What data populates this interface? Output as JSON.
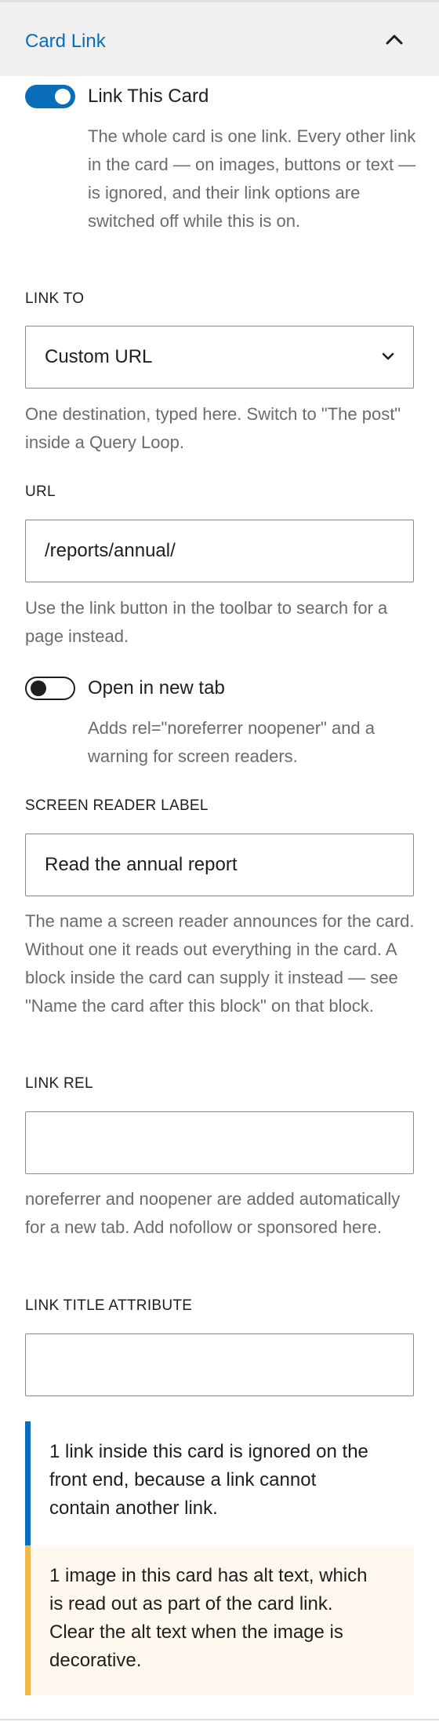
{
  "colors": {
    "accent": "#0a6dbb",
    "info_bar": "#0a6dbb",
    "warning_bar": "#f0b849",
    "warning_bg": "#fef8ee"
  },
  "panel": {
    "title": "Card Link",
    "collapse_icon": "chevron-up-icon"
  },
  "link_card": {
    "toggle_label": "Link This Card",
    "enabled": true,
    "help": "The whole card is one link. Every other link in the card — on images, buttons or text — is ignored, and their link options are switched off while this is on."
  },
  "link_to": {
    "label": "LINK TO",
    "value": "Custom URL",
    "help": "One destination, typed here. Switch to \"The post\" inside a Query Loop."
  },
  "url": {
    "label": "URL",
    "value": "/reports/annual/",
    "help": "Use the link button in the toolbar to search for a page instead."
  },
  "new_tab": {
    "toggle_label": "Open in new tab",
    "enabled": false,
    "help": "Adds rel=\"noreferrer noopener\" and a warning for screen readers."
  },
  "screen_reader_label": {
    "label": "SCREEN READER LABEL",
    "value": "Read the annual report",
    "help": "The name a screen reader announces for the card. Without one it reads out everything in the card. A block inside the card can supply it instead — see \"Name the card after this block\" on that block."
  },
  "link_rel": {
    "label": "LINK REL",
    "value": "",
    "help": "noreferrer and noopener are added automatically for a new tab. Add nofollow or sponsored here."
  },
  "link_title": {
    "label": "LINK TITLE ATTRIBUTE",
    "value": ""
  },
  "notices": {
    "info": "1 link inside this card is ignored on the front end, because a link cannot contain another link.",
    "warning": "1 image in this card has alt text, which is read out as part of the card link. Clear the alt text when the image is decorative."
  }
}
